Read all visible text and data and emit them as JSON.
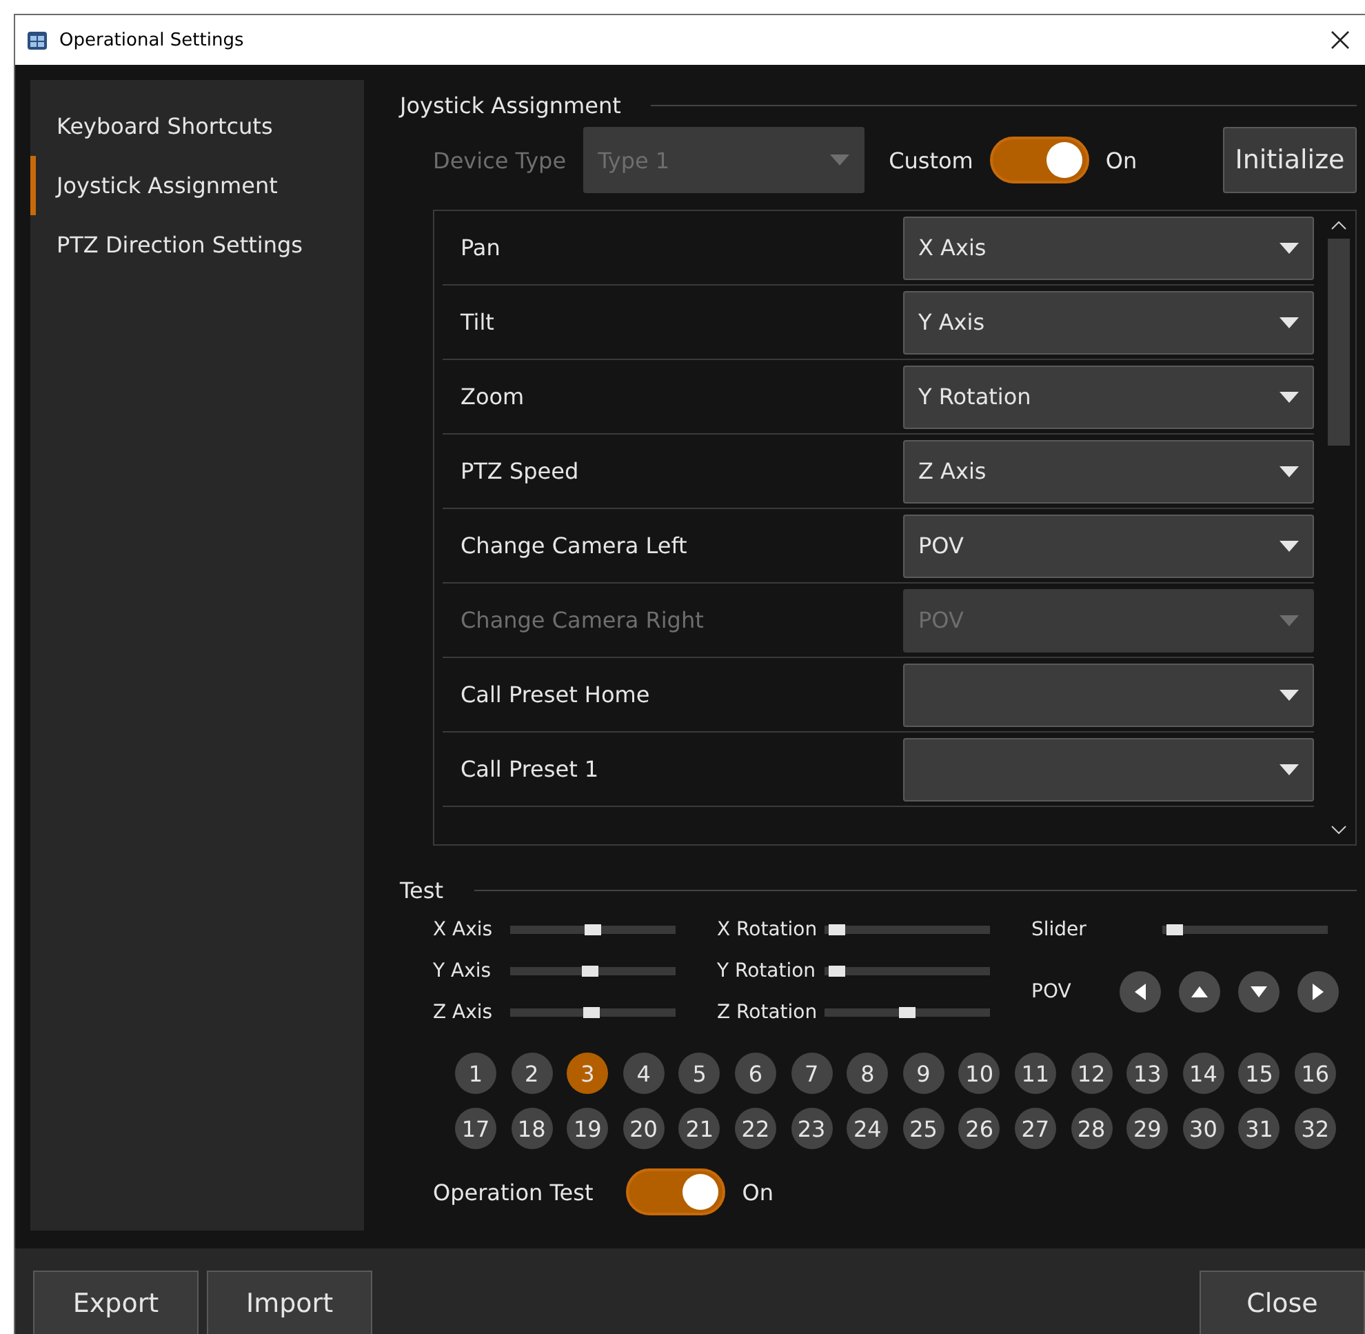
{
  "window": {
    "title": "Operational Settings"
  },
  "sidebar": {
    "items": [
      {
        "label": "Keyboard Shortcuts",
        "selected": false
      },
      {
        "label": "Joystick Assignment",
        "selected": true
      },
      {
        "label": "PTZ Direction Settings",
        "selected": false
      }
    ]
  },
  "joystick_assignment": {
    "title": "Joystick Assignment",
    "device_type": {
      "label": "Device Type",
      "value": "Type 1",
      "disabled": true
    },
    "custom": {
      "label": "Custom",
      "on": true,
      "state_label": "On"
    },
    "initialize_button": "Initialize",
    "assignments": [
      {
        "label": "Pan",
        "value": "X Axis",
        "disabled": false
      },
      {
        "label": "Tilt",
        "value": "Y Axis",
        "disabled": false
      },
      {
        "label": "Zoom",
        "value": "Y Rotation",
        "disabled": false
      },
      {
        "label": "PTZ Speed",
        "value": "Z Axis",
        "disabled": false
      },
      {
        "label": "Change Camera Left",
        "value": "POV",
        "disabled": false
      },
      {
        "label": "Change Camera Right",
        "value": "POV",
        "disabled": true
      },
      {
        "label": "Call Preset Home",
        "disabled": false
      },
      {
        "label": "Call Preset 1",
        "disabled": false
      }
    ]
  },
  "test": {
    "title": "Test",
    "axes": [
      {
        "label": "X Axis",
        "level": 0.5
      },
      {
        "label": "Y Axis",
        "level": 0.48
      },
      {
        "label": "Z Axis",
        "level": 0.49
      },
      {
        "label": "X Rotation",
        "level": 0.03
      },
      {
        "label": "Y Rotation",
        "level": 0.03
      },
      {
        "label": "Z Rotation",
        "level": 0.5
      },
      {
        "label": "Slider",
        "level": 0.03
      }
    ],
    "pov_label": "POV",
    "buttons": [
      {
        "label": "1",
        "selected": false
      },
      {
        "label": "2",
        "selected": false
      },
      {
        "label": "3",
        "selected": true
      },
      {
        "label": "4",
        "selected": false
      },
      {
        "label": "5",
        "selected": false
      },
      {
        "label": "6",
        "selected": false
      },
      {
        "label": "7",
        "selected": false
      },
      {
        "label": "8",
        "selected": false
      },
      {
        "label": "9",
        "selected": false
      },
      {
        "label": "10",
        "selected": false
      },
      {
        "label": "11",
        "selected": false
      },
      {
        "label": "12",
        "selected": false
      },
      {
        "label": "13",
        "selected": false
      },
      {
        "label": "14",
        "selected": false
      },
      {
        "label": "15",
        "selected": false
      },
      {
        "label": "16",
        "selected": false
      },
      {
        "label": "17",
        "selected": false
      },
      {
        "label": "18",
        "selected": false
      },
      {
        "label": "19",
        "selected": false
      },
      {
        "label": "20",
        "selected": false
      },
      {
        "label": "21",
        "selected": false
      },
      {
        "label": "22",
        "selected": false
      },
      {
        "label": "23",
        "selected": false
      },
      {
        "label": "24",
        "selected": false
      },
      {
        "label": "25",
        "selected": false
      },
      {
        "label": "26",
        "selected": false
      },
      {
        "label": "27",
        "selected": false
      },
      {
        "label": "28",
        "selected": false
      },
      {
        "label": "29",
        "selected": false
      },
      {
        "label": "30",
        "selected": false
      },
      {
        "label": "31",
        "selected": false
      },
      {
        "label": "32",
        "selected": false
      }
    ],
    "operation_test": {
      "label": "Operation Test",
      "on": true,
      "state_label": "On"
    }
  },
  "footer": {
    "left_buttons": [
      "Export",
      "Import"
    ],
    "right_button": "Close"
  }
}
